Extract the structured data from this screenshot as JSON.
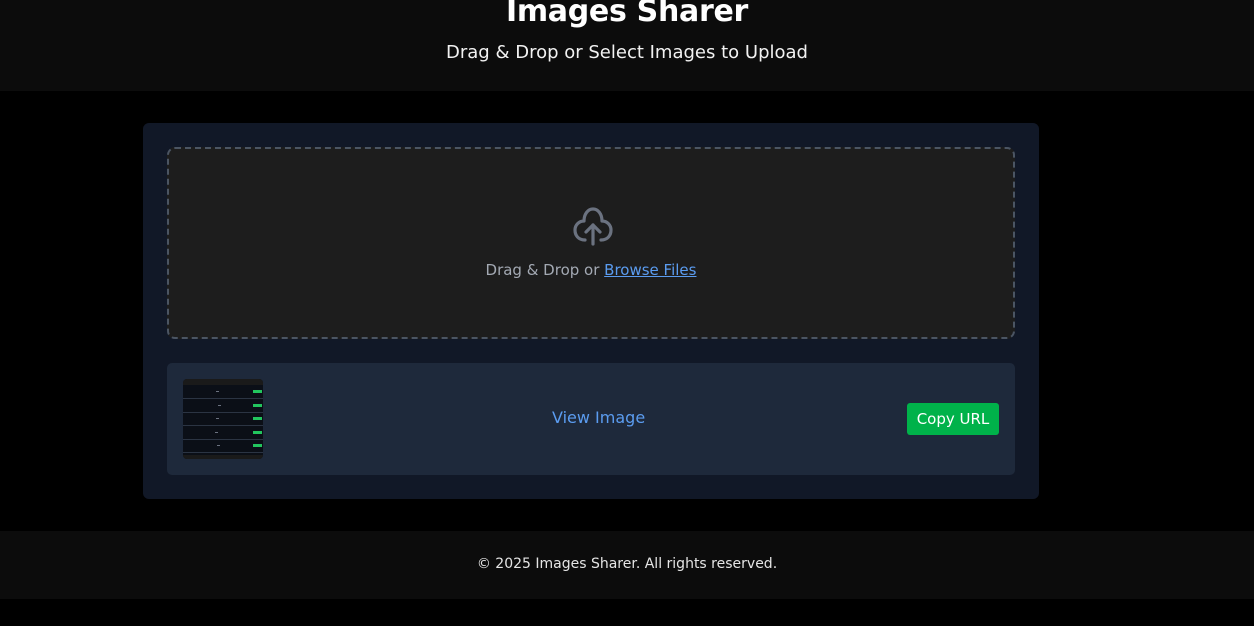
{
  "header": {
    "title": "Images Sharer",
    "subtitle": "Drag & Drop or Select Images to Upload"
  },
  "dropzone": {
    "icon": "upload-cloud-icon",
    "text": "Drag & Drop or",
    "browse_label": "Browse Files"
  },
  "uploads": [
    {
      "thumbnail": "image-thumbnail",
      "view_label": "View Image",
      "copy_label": "Copy URL"
    }
  ],
  "footer": {
    "text": "© 2025 Images Sharer. All rights reserved."
  },
  "colors": {
    "background": "#000000",
    "header_bg": "#0c0c0c",
    "container_bg": "#111827",
    "dropzone_bg": "#1d1d1d",
    "row_bg": "#1e293b",
    "link": "#5b9cf0",
    "copy_button": "#00b24a"
  }
}
